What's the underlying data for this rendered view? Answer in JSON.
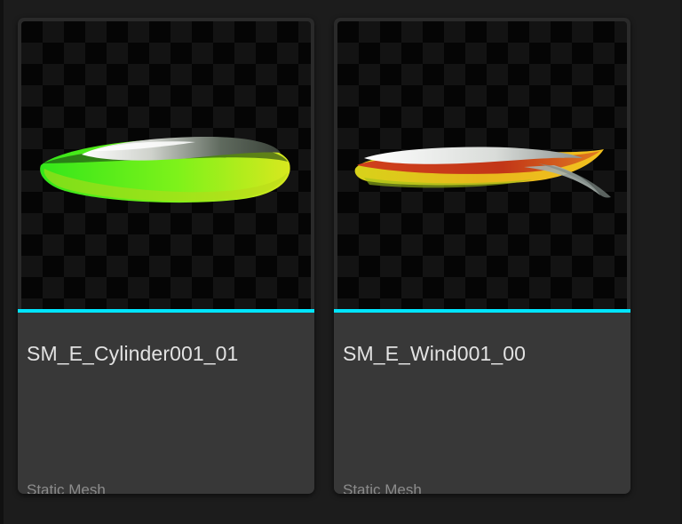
{
  "colors": {
    "accent": "#00E5FF",
    "tile_bg": "#383838",
    "panel_bg": "#1c1c1c"
  },
  "assets": [
    {
      "name": "SM_E_Cylinder001_01",
      "type": "Static Mesh",
      "thumbnail_icon": "green-disc-mesh-preview"
    },
    {
      "name": "SM_E_Wind001_00",
      "type": "Static Mesh",
      "thumbnail_icon": "wind-streak-mesh-preview"
    }
  ]
}
